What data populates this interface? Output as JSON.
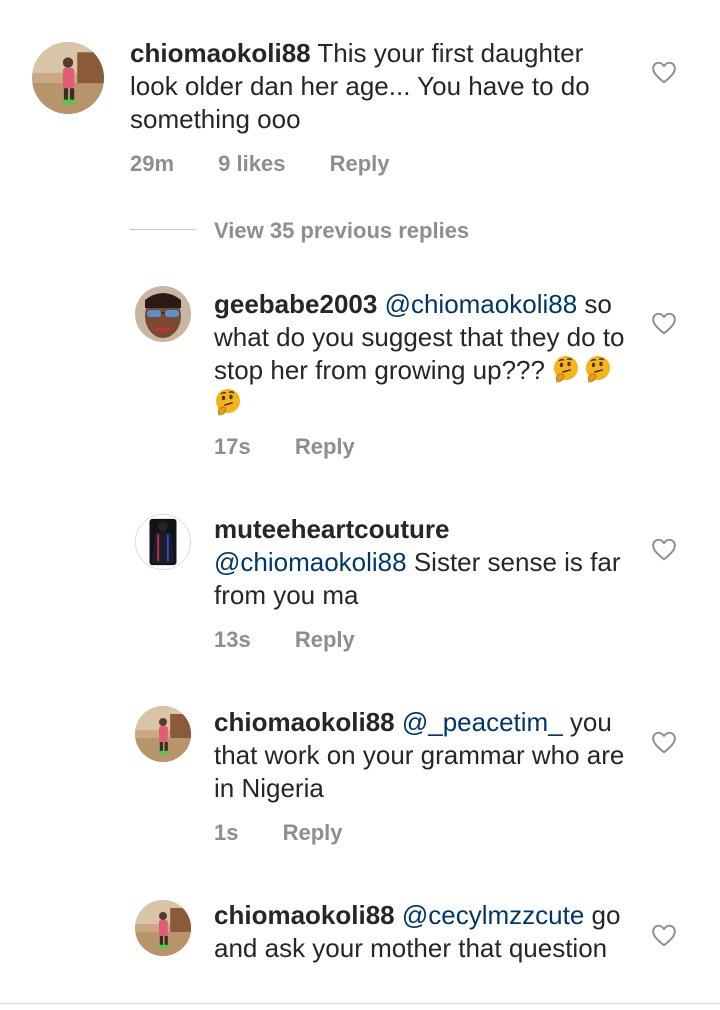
{
  "top_comment": {
    "username": "chiomaokoli88",
    "text": "This your first daughter look older dan her age... You have to do something  ooo",
    "time": "29m",
    "likes": "9 likes",
    "reply": "Reply"
  },
  "view_previous": "View 35 previous replies",
  "replies": [
    {
      "username": "geebabe2003",
      "mention": "@chiomaokoli88",
      "text": "so what do you suggest that they do to stop her from growing up???",
      "emoji": "thinking-face",
      "time": "17s",
      "reply": "Reply"
    },
    {
      "username": "muteeheartcouture",
      "mention": "@chiomaokoli88",
      "text": "Sister sense is far from you ma",
      "time": "13s",
      "reply": "Reply"
    },
    {
      "username": "chiomaokoli88",
      "mention": "@_peacetim_",
      "text": "you that work on your grammar who are in Nigeria",
      "time": "1s",
      "reply": "Reply"
    },
    {
      "username": "chiomaokoli88",
      "mention": "@cecylmzzcute",
      "text": "go and ask your mother that question",
      "time": "",
      "reply": ""
    }
  ],
  "colors": {
    "text": "#262626",
    "secondary": "#8e8e8e",
    "mention": "#00376b",
    "emoji": "#f5b41b"
  }
}
